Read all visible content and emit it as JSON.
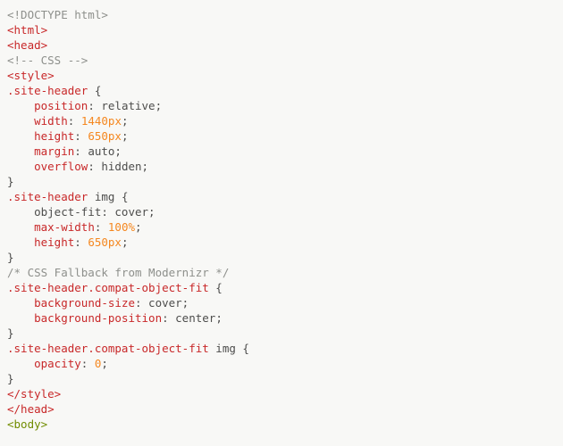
{
  "lines": [
    [
      {
        "t": "<!DOCTYPE html>",
        "c": "gray"
      }
    ],
    [
      {
        "t": "<html>",
        "c": "red"
      }
    ],
    [
      {
        "t": "<head>",
        "c": "red"
      }
    ],
    [
      {
        "t": "<!-- CSS -->",
        "c": "gray"
      }
    ],
    [
      {
        "t": "<style>",
        "c": "red"
      }
    ],
    [
      {
        "t": ".site-header",
        "c": "red"
      },
      {
        "t": " {",
        "c": "text"
      }
    ],
    [
      {
        "t": "    "
      },
      {
        "t": "position",
        "c": "red"
      },
      {
        "t": ": relative;",
        "c": "text"
      }
    ],
    [
      {
        "t": "    "
      },
      {
        "t": "width",
        "c": "red"
      },
      {
        "t": ": ",
        "c": "text"
      },
      {
        "t": "1440px",
        "c": "orange"
      },
      {
        "t": ";",
        "c": "text"
      }
    ],
    [
      {
        "t": "    "
      },
      {
        "t": "height",
        "c": "red"
      },
      {
        "t": ": ",
        "c": "text"
      },
      {
        "t": "650px",
        "c": "orange"
      },
      {
        "t": ";",
        "c": "text"
      }
    ],
    [
      {
        "t": "    "
      },
      {
        "t": "margin",
        "c": "red"
      },
      {
        "t": ": auto;",
        "c": "text"
      }
    ],
    [
      {
        "t": "    "
      },
      {
        "t": "overflow",
        "c": "red"
      },
      {
        "t": ": hidden;",
        "c": "text"
      }
    ],
    [
      {
        "t": "}",
        "c": "text"
      }
    ],
    [
      {
        "t": ".site-header",
        "c": "red"
      },
      {
        "t": " img {",
        "c": "text"
      }
    ],
    [
      {
        "t": "    object-fit: cover;",
        "c": "text"
      }
    ],
    [
      {
        "t": "    "
      },
      {
        "t": "max-width",
        "c": "red"
      },
      {
        "t": ": ",
        "c": "text"
      },
      {
        "t": "100%",
        "c": "orange"
      },
      {
        "t": ";",
        "c": "text"
      }
    ],
    [
      {
        "t": "    "
      },
      {
        "t": "height",
        "c": "red"
      },
      {
        "t": ": ",
        "c": "text"
      },
      {
        "t": "650px",
        "c": "orange"
      },
      {
        "t": ";",
        "c": "text"
      }
    ],
    [
      {
        "t": "}",
        "c": "text"
      }
    ],
    [
      {
        "t": "/* CSS Fallback from Modernizr */",
        "c": "gray"
      }
    ],
    [
      {
        "t": ".site-header.compat-object-fit",
        "c": "red"
      },
      {
        "t": " {",
        "c": "text"
      }
    ],
    [
      {
        "t": "    "
      },
      {
        "t": "background-size",
        "c": "red"
      },
      {
        "t": ": cover;",
        "c": "text"
      }
    ],
    [
      {
        "t": "    "
      },
      {
        "t": "background-position",
        "c": "red"
      },
      {
        "t": ": center;",
        "c": "text"
      }
    ],
    [
      {
        "t": "}",
        "c": "text"
      }
    ],
    [
      {
        "t": ".site-header.compat-object-fit",
        "c": "red"
      },
      {
        "t": " img {",
        "c": "text"
      }
    ],
    [
      {
        "t": "    "
      },
      {
        "t": "opacity",
        "c": "red"
      },
      {
        "t": ": ",
        "c": "text"
      },
      {
        "t": "0",
        "c": "orange"
      },
      {
        "t": ";",
        "c": "text"
      }
    ],
    [
      {
        "t": "}",
        "c": "text"
      }
    ],
    [
      {
        "t": "</style>",
        "c": "red"
      }
    ],
    [
      {
        "t": "</head>",
        "c": "red"
      }
    ],
    [
      {
        "t": "<body>",
        "c": "green"
      }
    ]
  ]
}
